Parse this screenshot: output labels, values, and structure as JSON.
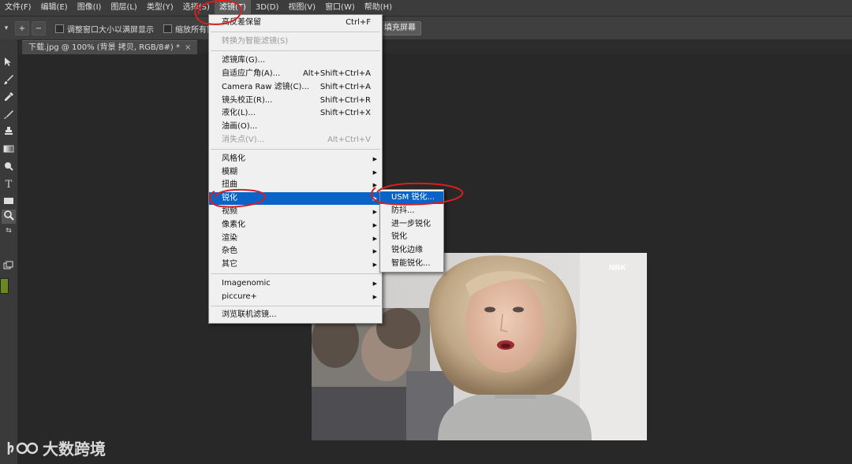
{
  "menubar": {
    "items": [
      "文件(F)",
      "编辑(E)",
      "图像(I)",
      "图层(L)",
      "类型(Y)",
      "选择(S)",
      "滤镜(T)",
      "3D(D)",
      "视图(V)",
      "窗口(W)",
      "帮助(H)"
    ]
  },
  "options_bar": {
    "checkbox1": "调整窗口大小以满屏显示",
    "checkbox2": "缩放所有窗",
    "fill_button": "填充屏幕"
  },
  "document_tab": {
    "title": "下载.jpg @ 100% (背景 拷贝, RGB/8#) *",
    "close": "×"
  },
  "filter_menu": {
    "last_filter": {
      "label": "高反差保留",
      "shortcut": "Ctrl+F"
    },
    "convert_smart": "转换为智能滤镜(S)",
    "gallery": "滤镜库(G)...",
    "adaptive_wide": {
      "label": "自适应广角(A)...",
      "shortcut": "Alt+Shift+Ctrl+A"
    },
    "camera_raw": {
      "label": "Camera Raw 滤镜(C)...",
      "shortcut": "Shift+Ctrl+A"
    },
    "lens_correction": {
      "label": "镜头校正(R)...",
      "shortcut": "Shift+Ctrl+R"
    },
    "liquify": {
      "label": "液化(L)...",
      "shortcut": "Shift+Ctrl+X"
    },
    "oil_paint": "油画(O)...",
    "vanishing_point": {
      "label": "消失点(V)...",
      "shortcut": "Alt+Ctrl+V"
    },
    "stylize": "风格化",
    "blur": "模糊",
    "distort": "扭曲",
    "sharpen": "锐化",
    "video": "视频",
    "pixelate": "像素化",
    "render": "渲染",
    "noise": "杂色",
    "other": "其它",
    "imagenomic": "Imagenomic",
    "piccure": "piccure+",
    "browse_online": "浏览联机滤镜..."
  },
  "sharpen_submenu": {
    "usm": "USM 锐化...",
    "shake_reduction": "防抖...",
    "sharpen_more": "进一步锐化",
    "sharpen": "锐化",
    "sharpen_edges": "锐化边缘",
    "smart_sharpen": "智能锐化..."
  },
  "photo": {
    "badge": "NRK"
  },
  "watermark": {
    "text": "大数跨境"
  },
  "colors": {
    "menu_highlight": "#0a64c8",
    "annotation": "#d42020",
    "foreground_swatch": "#6a8a1e"
  }
}
